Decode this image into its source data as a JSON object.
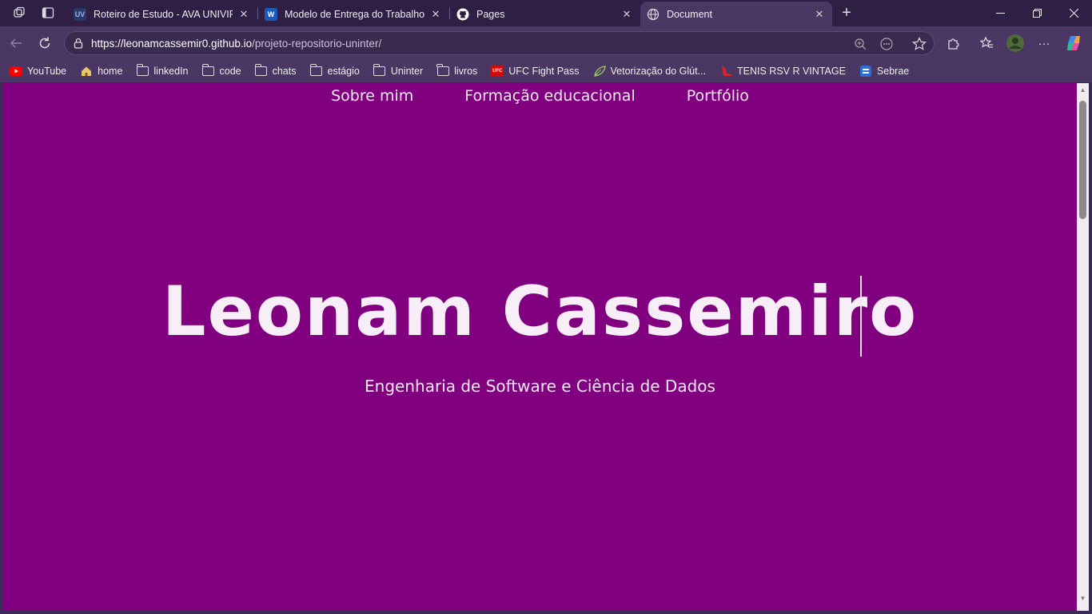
{
  "tabs": [
    {
      "title": "Roteiro de Estudo - AVA UNIVIRTUS",
      "favicon": "univirtus-logo",
      "favicon_text": "UV",
      "active": false
    },
    {
      "title": "Modelo de Entrega do Trabalho_Cibersegurança",
      "favicon": "word-icon",
      "favicon_text": "W",
      "active": false
    },
    {
      "title": "Pages",
      "favicon": "github-icon",
      "active": false
    },
    {
      "title": "Document",
      "favicon": "globe-icon",
      "active": true
    }
  ],
  "toolbar": {
    "url_host": "https://leonamcassemir0.github.io",
    "url_path": "/projeto-repositorio-uninter/"
  },
  "bookmarks": [
    {
      "label": "YouTube",
      "icon": "youtube-icon"
    },
    {
      "label": "home",
      "icon": "home-icon"
    },
    {
      "label": "linkedIn",
      "icon": "folder-icon"
    },
    {
      "label": "code",
      "icon": "folder-icon"
    },
    {
      "label": "chats",
      "icon": "folder-icon"
    },
    {
      "label": "estágio",
      "icon": "folder-icon"
    },
    {
      "label": "Uninter",
      "icon": "folder-icon"
    },
    {
      "label": "livros",
      "icon": "folder-icon"
    },
    {
      "label": "UFC Fight Pass",
      "icon": "ufc-icon",
      "icon_text": "UFC"
    },
    {
      "label": "Vetorização do Glút...",
      "icon": "leaf-icon"
    },
    {
      "label": "TENIS RSV R VINTAGE",
      "icon": "shoe-icon"
    },
    {
      "label": "Sebrae",
      "icon": "sebrae-icon"
    }
  ],
  "page": {
    "nav": [
      "Sobre mim",
      "Formação educacional",
      "Portfólio"
    ],
    "name": "Leonam Cassemiro",
    "subtitle": "Engenharia de Software e Ciência de Dados"
  },
  "colors": {
    "page_background": "#800080",
    "browser_frame": "#4b3763",
    "tab_strip": "#2f1f45"
  }
}
